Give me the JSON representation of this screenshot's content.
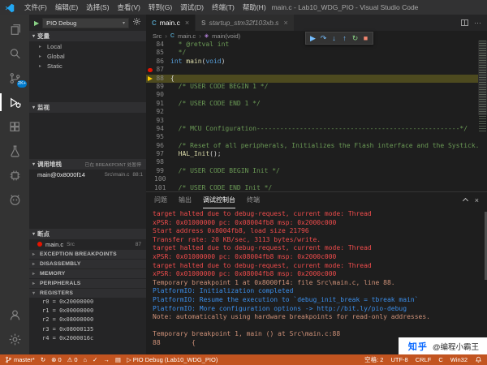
{
  "window": {
    "title": "main.c - Lab10_WDG_PIO - Visual Studio Code"
  },
  "menubar": {
    "items": [
      "文件(F)",
      "编辑(E)",
      "选择(S)",
      "查看(V)",
      "转到(G)",
      "调试(D)",
      "终端(T)",
      "帮助(H)"
    ]
  },
  "activity_bar": {
    "source_control_badge": "2K+",
    "icons": [
      "explorer",
      "search",
      "source-control",
      "run-and-debug",
      "extensions",
      "test",
      "peripherals",
      "platformio",
      "account",
      "settings"
    ]
  },
  "debug_sidebar": {
    "launch_config": "PIO Debug",
    "variables": {
      "title": "变量",
      "items": [
        "Local",
        "Global",
        "Static"
      ]
    },
    "watch": {
      "title": "监视"
    },
    "call_stack": {
      "title": "调用堆栈",
      "pause_reason": "已在 BREAKPOINT 处暂停",
      "frame": {
        "name": "main@0x8000f14",
        "file": "Src\\main.c",
        "position": "88:1"
      }
    },
    "breakpoints": {
      "title": "断点",
      "item": {
        "file": "main.c",
        "folder": "Src",
        "line": "87"
      }
    },
    "collapsed_sections": [
      "EXCEPTION BREAKPOINTS",
      "DISASSEMBLY",
      "MEMORY",
      "PERIPHERALS"
    ],
    "registers": {
      "title": "REGISTERS",
      "items": [
        "r0 = 0x20000000",
        "r1 = 0x00000000",
        "r2 = 0x08000000",
        "r3 = 0x08000135",
        "r4 = 0x2000016c"
      ]
    }
  },
  "editor": {
    "tabs": [
      {
        "label": "main.c",
        "icon": "c-file-icon",
        "state": "active"
      },
      {
        "label": "startup_stm32f103xb.s",
        "icon": "asm-file-icon",
        "state": "preview"
      }
    ],
    "breadcrumb": {
      "items": [
        "Src",
        "main.c",
        "main(void)"
      ]
    },
    "debug_toolbar": [
      "continue",
      "step-over",
      "step-into",
      "step-out",
      "restart",
      "stop"
    ],
    "breakpoint_line": 87,
    "current_line": 88,
    "lines": [
      {
        "num": 84,
        "segs": [
          {
            "t": "  * @retval int",
            "c": "c-com"
          }
        ]
      },
      {
        "num": 85,
        "segs": [
          {
            "t": "  */",
            "c": "c-com"
          }
        ]
      },
      {
        "num": 86,
        "segs": [
          {
            "t": "int ",
            "c": "c-kw"
          },
          {
            "t": "main",
            "c": "c-fn"
          },
          {
            "t": "(",
            "c": "c-pl"
          },
          {
            "t": "void",
            "c": "c-kw"
          },
          {
            "t": ")",
            "c": "c-pl"
          }
        ]
      },
      {
        "num": 87,
        "bp": true,
        "segs": []
      },
      {
        "num": 88,
        "cur": true,
        "segs": [
          {
            "t": "{",
            "c": "c-pl"
          }
        ]
      },
      {
        "num": 89,
        "segs": [
          {
            "t": "  /* USER CODE BEGIN 1 */",
            "c": "c-com"
          }
        ]
      },
      {
        "num": 90,
        "segs": []
      },
      {
        "num": 91,
        "segs": [
          {
            "t": "  /* USER CODE END 1 */",
            "c": "c-com"
          }
        ]
      },
      {
        "num": 92,
        "segs": []
      },
      {
        "num": 93,
        "segs": []
      },
      {
        "num": 94,
        "segs": [
          {
            "t": "  /* MCU Configuration----------------------------------------------------*/",
            "c": "c-com"
          }
        ]
      },
      {
        "num": 95,
        "segs": []
      },
      {
        "num": 96,
        "segs": [
          {
            "t": "  /* Reset of all peripherals, Initializes the Flash interface and the Systick. */",
            "c": "c-com"
          }
        ]
      },
      {
        "num": 97,
        "segs": [
          {
            "t": "  ",
            "c": "c-pl"
          },
          {
            "t": "HAL_Init",
            "c": "c-fn"
          },
          {
            "t": "();",
            "c": "c-pl"
          }
        ]
      },
      {
        "num": 98,
        "segs": []
      },
      {
        "num": 99,
        "segs": [
          {
            "t": "  /* USER CODE BEGIN Init */",
            "c": "c-com"
          }
        ]
      },
      {
        "num": 100,
        "segs": []
      },
      {
        "num": 101,
        "segs": [
          {
            "t": "  /* USER CODE END Init */",
            "c": "c-com"
          }
        ]
      }
    ]
  },
  "panel": {
    "tabs": [
      {
        "label": "问题"
      },
      {
        "label": "输出"
      },
      {
        "label": "调试控制台",
        "active": true
      },
      {
        "label": "终端"
      }
    ],
    "console_lines": [
      {
        "text": "target halted due to debug-request, current mode: Thread",
        "cls": "ln-err"
      },
      {
        "text": "xPSR: 0x01000000 pc: 0x08004fb8 msp: 0x2000c000",
        "cls": "ln-err"
      },
      {
        "text": "Start address 0x8004fb8, load size 21796",
        "cls": "ln-err"
      },
      {
        "text": "Transfer rate: 20 KB/sec, 3113 bytes/write.",
        "cls": "ln-err"
      },
      {
        "text": "target halted due to debug-request, current mode: Thread",
        "cls": "ln-err"
      },
      {
        "text": "xPSR: 0x01000000 pc: 0x08004fb8 msp: 0x2000c000",
        "cls": "ln-err"
      },
      {
        "text": "target halted due to debug-request, current mode: Thread",
        "cls": "ln-err"
      },
      {
        "text": "xPSR: 0x01000000 pc: 0x08004fb8 msp: 0x2000c000",
        "cls": "ln-err"
      },
      {
        "text": "Temporary breakpoint 1 at 0x8000f14: file Src\\main.c, line 88.",
        "cls": "ln-warn"
      },
      {
        "text": "PlatformIO: Initialization completed",
        "cls": "ln-info"
      },
      {
        "text": "PlatformIO: Resume the execution to `debug_init_break = tbreak main`",
        "cls": "ln-info"
      },
      {
        "text": "PlatformIO: More configuration options -> http://bit.ly/pio-debug",
        "cls": "ln-info"
      },
      {
        "text": "Note: automatically using hardware breakpoints for read-only addresses.",
        "cls": "ln-warn"
      },
      {
        "text": "",
        "cls": "ln-out"
      },
      {
        "text": "Temporary breakpoint 1, main () at Src\\main.c:88",
        "cls": "ln-warn"
      },
      {
        "text": "88        {",
        "cls": "ln-warn"
      }
    ]
  },
  "status_bar": {
    "branch": "master*",
    "errors": "0",
    "warnings": "0",
    "debug_status": "PIO Debug (Lab10_WDG_PIO)",
    "indentation": "空格: 2",
    "encoding": "UTF-8",
    "eol": "CRLF",
    "language": "C",
    "platform": "Win32"
  },
  "watermark": {
    "brand": "知乎",
    "handle": "@编程小霸王"
  },
  "colors": {
    "accent": "#007acc",
    "statusbar_debugging": "#c25420",
    "breakpoint_red": "#e51400",
    "current_line_highlight": "#4d4a1f",
    "console_error": "#f14c4c",
    "console_info": "#3b8eea",
    "console_warn": "#ce9178"
  }
}
